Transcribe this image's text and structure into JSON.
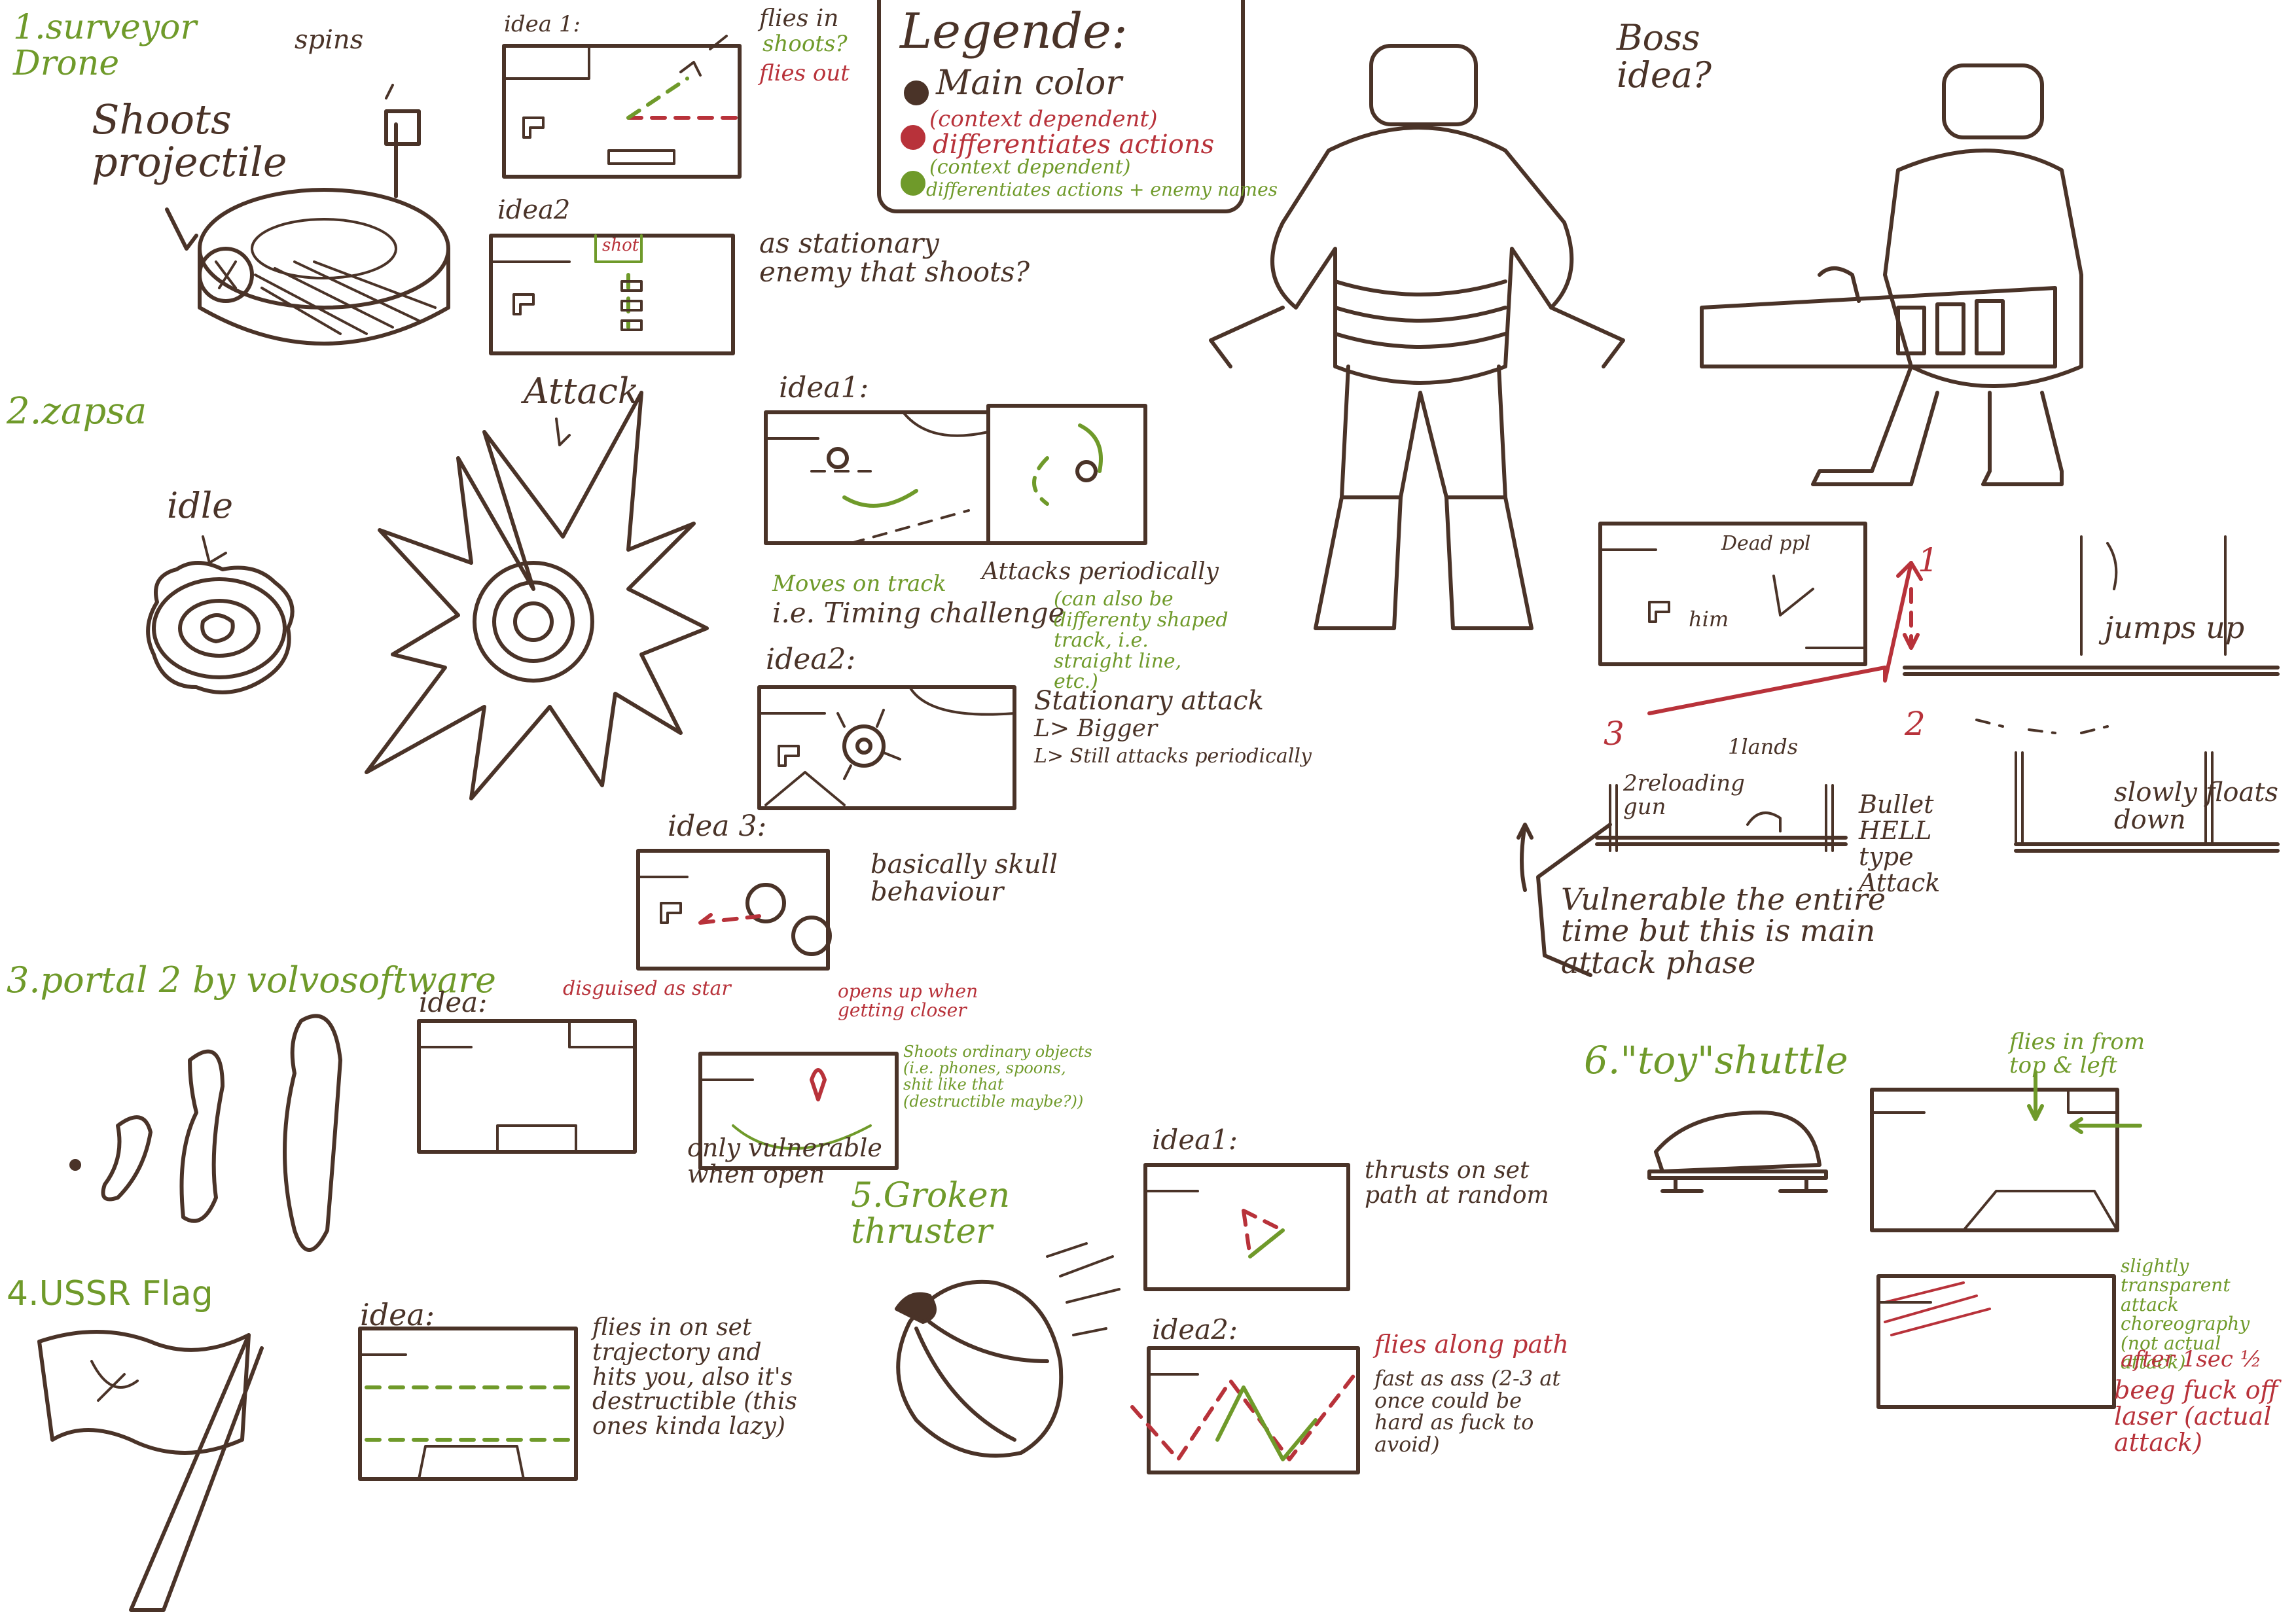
{
  "surveyor": {
    "heading": "1.surveyor Drone",
    "note_spins": "spins",
    "note_shoots": "Shoots projectile",
    "idea1_label": "idea 1:",
    "idea1_note_a": "flies in",
    "idea1_note_b": "shoots?",
    "idea1_note_c": "flies out",
    "idea2_label": "idea2",
    "idea2_shot": "shot",
    "idea2_note": "as stationary enemy that shoots?"
  },
  "legend": {
    "title": "Legende:",
    "main_color": "Main color",
    "red_line1": "(context dependent)",
    "red_line2": "differentiates actions",
    "green_line1": "(context dependent)",
    "green_line2": "differentiates actions + enemy names",
    "colors": {
      "main": "#4a3328",
      "red": "#b8323a",
      "green": "#6f9a2a"
    }
  },
  "boss": {
    "heading": "Boss idea?",
    "dead_ppl": "Dead ppl",
    "him": "him",
    "step1": "1",
    "step2": "2",
    "step3": "3",
    "jumps_up": "jumps up",
    "lands": "1lands",
    "reloading": "2reloading gun",
    "bullet_hell": "Bullet HELL type Attack",
    "slowly": "slowly floats down",
    "vulnerable": "Vulnerable the entire time but this is main attack phase"
  },
  "zapsa": {
    "heading": "2.zapsa",
    "idle": "idle",
    "attack": "Attack",
    "idea1_label": "idea1:",
    "moves_on_track": "Moves on track",
    "timing": "i.e. Timing challenge",
    "attacks_periodically": "Attacks periodically",
    "can_also_be": "(can also be differenty shaped track, i.e. straight line, etc.)",
    "idea2_label": "idea2:",
    "stationary_attack": "Stationary attack",
    "bigger": "L> Bigger",
    "still_attacks": "L> Still attacks periodically",
    "idea3_label": "idea 3:",
    "basically_skull": "basically skull behaviour"
  },
  "portal": {
    "heading": "3.portal 2 by volvosoftware",
    "idea_label": "idea:",
    "disguised": "disguised as star",
    "opens_up": "opens up when getting closer",
    "shoots_objects": "Shoots ordinary objects (i.e. phones, spoons, shit like that (destructible maybe?))",
    "only_vulnerable": "only vulnerable when open"
  },
  "ussr": {
    "heading": "4.USSR Flag",
    "idea_label": "idea:",
    "flies_in": "flies in on set trajectory and hits you, also it's destructible (this ones kinda lazy)"
  },
  "thruster": {
    "heading": "5.Groken thruster",
    "idea1_label": "idea1:",
    "thrusts": "thrusts on set path at random",
    "idea2_label": "idea2:",
    "flies_along": "flies along path",
    "fast": "fast as ass (2-3 at once could be hard as fuck to avoid)"
  },
  "shuttle": {
    "heading": "6.\"toy\"shuttle",
    "flies_in_from": "flies in from top & left",
    "slightly": "slightly transparent attack choreography (not actual attack)",
    "after": "after 1sec ½",
    "laser": "beeg fuck off laser (actual attack)"
  }
}
